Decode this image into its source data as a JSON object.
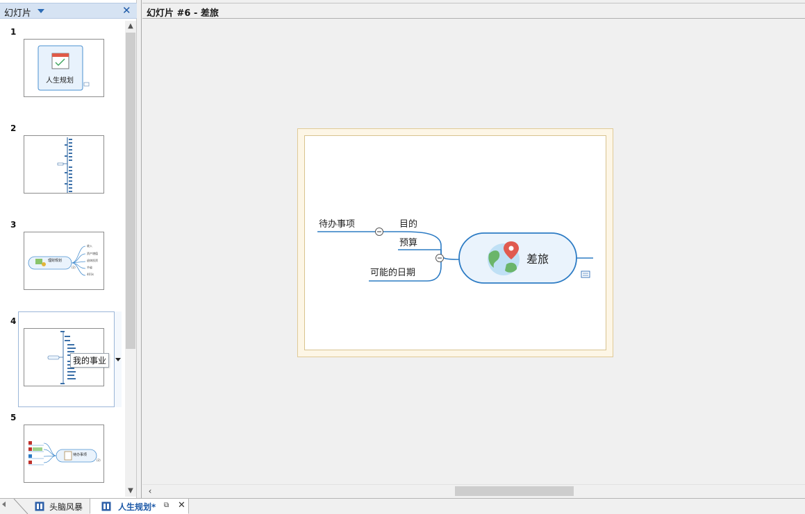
{
  "left_panel": {
    "title": "幻灯片",
    "slides": [
      {
        "number": "1",
        "thumb_text": "人生规划"
      },
      {
        "number": "2",
        "thumb_text": ""
      },
      {
        "number": "3",
        "thumb_text": "理财规划"
      },
      {
        "number": "4",
        "thumb_text": "",
        "tooltip": "我的事业"
      },
      {
        "number": "5",
        "thumb_text": "待办事项"
      }
    ]
  },
  "main": {
    "title": "幻灯片 #6 - 差旅",
    "slide": {
      "central_topic": "差旅",
      "branches": [
        "目的",
        "预算",
        "可能的日期"
      ],
      "subtopic": "待办事项"
    }
  },
  "tabs": [
    {
      "label": "头脑风暴",
      "active": false
    },
    {
      "label": "人生规划*",
      "active": true
    }
  ],
  "colors": {
    "accent": "#2c7bc4",
    "panel_header": "#d6e3f3",
    "slide_border": "#e0ca96",
    "topic_fill": "#eaf3fc"
  }
}
